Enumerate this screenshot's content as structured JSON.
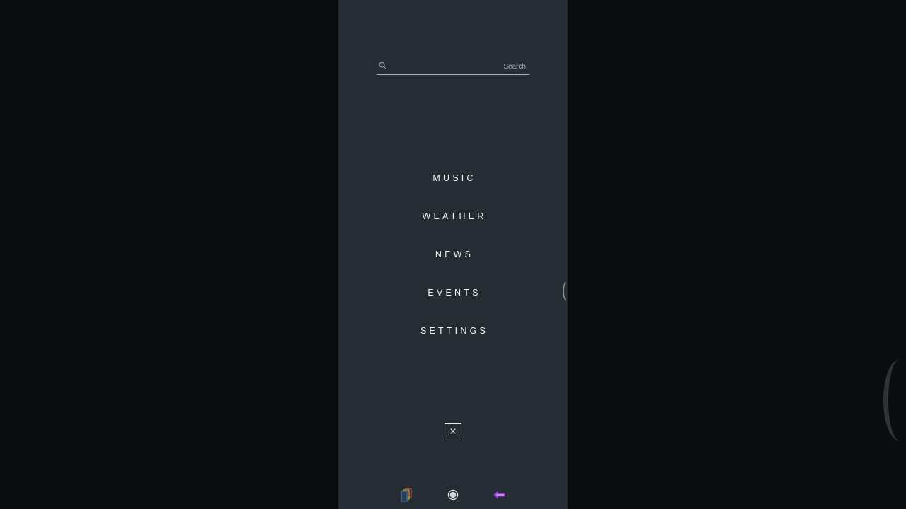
{
  "search": {
    "placeholder": "Search",
    "value": ""
  },
  "menu": {
    "items": [
      {
        "label": "MUSIC"
      },
      {
        "label": "WEATHER"
      },
      {
        "label": "NEWS"
      },
      {
        "label": "EVENTS"
      },
      {
        "label": "SETTINGS"
      }
    ]
  },
  "close": {
    "symbol": "×"
  },
  "navbar": {
    "recents_icon": "recents-icon",
    "home_icon": "home-icon",
    "back_icon": "back-arrow-icon",
    "back_color": "#8e3bd1"
  },
  "colors": {
    "background": "#0b0c10",
    "panel": "#262c34",
    "text": "#f2f4f6"
  }
}
